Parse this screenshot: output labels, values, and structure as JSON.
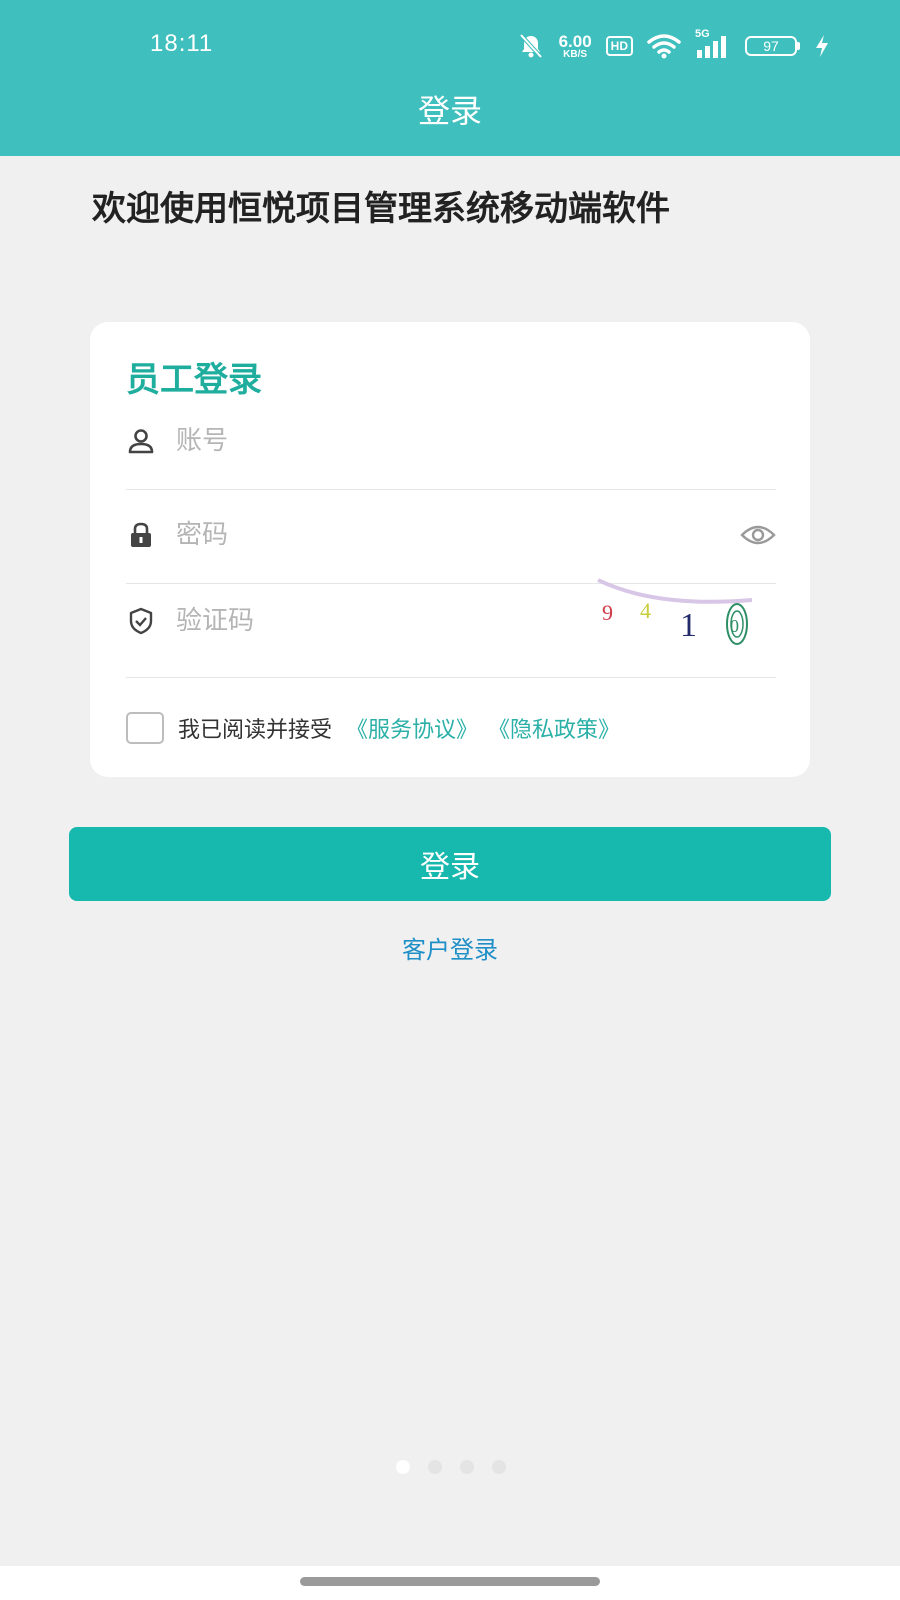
{
  "status_bar": {
    "time": "18:11",
    "net_speed_value": "6.00",
    "net_speed_unit": "KB/S",
    "hd_label": "HD",
    "signal_label": "5G",
    "battery_level": "97",
    "icons": [
      "mute-bell-icon",
      "wifi-icon",
      "signal-icon",
      "battery-icon",
      "charging-icon"
    ]
  },
  "header": {
    "title": "登录"
  },
  "welcome_text": "欢迎使用恒悦项目管理系统移动端软件",
  "card": {
    "title": "员工登录",
    "account_placeholder": "账号",
    "password_placeholder": "密码",
    "captcha_placeholder": "验证码",
    "captcha_chars": [
      "9",
      "4",
      "1",
      "0"
    ],
    "agree_text": "我已阅读并接受",
    "service_link": "《服务协议》",
    "privacy_link": "《隐私政策》"
  },
  "login_button": "登录",
  "client_login": "客户登录",
  "page_indicator": {
    "count": 4,
    "active": 0
  },
  "colors": {
    "header_bg": "#3fbfbd",
    "accent": "#1fae9e",
    "button_bg": "#17b8ad",
    "link": "#2bb0a8",
    "client_link": "#1f8fc7"
  }
}
